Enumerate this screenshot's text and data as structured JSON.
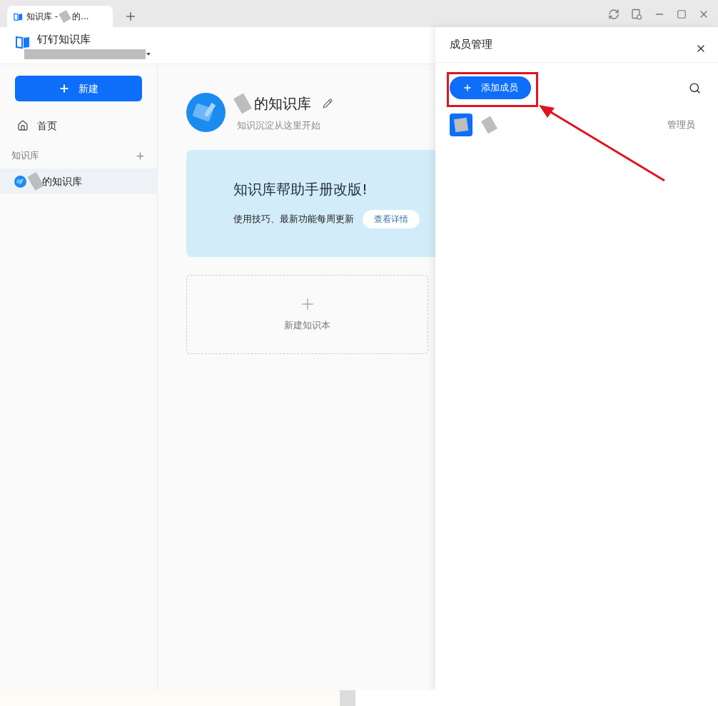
{
  "window": {
    "tab": {
      "title_start": "知识库 -",
      "title_end": "的...",
      "selected": true
    }
  },
  "header": {
    "app_name": "钉钉知识库"
  },
  "sidebar": {
    "new_button": "新建",
    "items": [
      {
        "label": "首页",
        "selected": false
      }
    ],
    "section": "知识库",
    "spaces": [
      {
        "name": "的知识库",
        "selected": true
      }
    ]
  },
  "main": {
    "title": "的知识库",
    "subtitle": "知识沉淀从这里开始",
    "banner": {
      "title": "知识库帮助手册改版!",
      "text": "使用技巧、最新功能每周更新",
      "button": "查看详情"
    },
    "new_book": "新建知识本"
  },
  "drawer": {
    "title": "成员管理",
    "add_button": "添加成员",
    "members": [
      {
        "role": "管理员"
      }
    ]
  }
}
